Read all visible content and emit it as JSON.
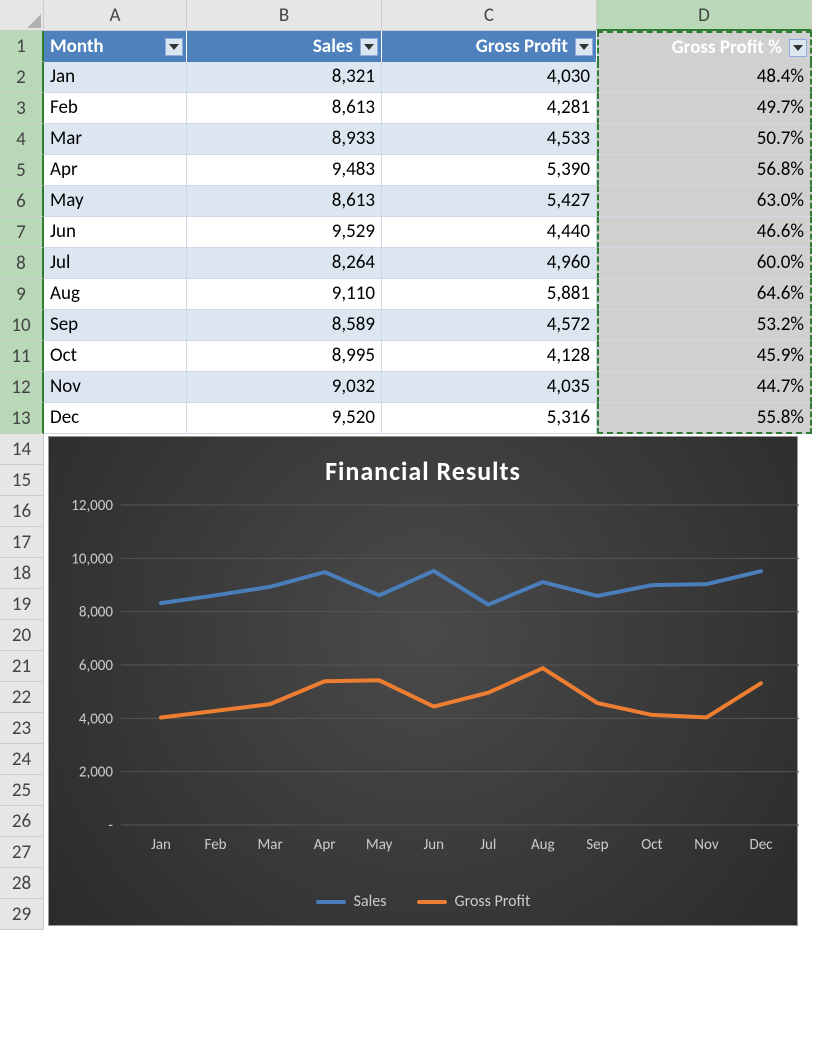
{
  "columns": [
    "A",
    "B",
    "C",
    "D"
  ],
  "headers": {
    "month": "Month",
    "sales": "Sales",
    "gross_profit": "Gross Profit",
    "gross_profit_pct": "Gross Profit %"
  },
  "rows": [
    {
      "n": 1
    },
    {
      "n": 2,
      "month": "Jan",
      "sales": "8,321",
      "gp": "4,030",
      "pct": "48.4%"
    },
    {
      "n": 3,
      "month": "Feb",
      "sales": "8,613",
      "gp": "4,281",
      "pct": "49.7%"
    },
    {
      "n": 4,
      "month": "Mar",
      "sales": "8,933",
      "gp": "4,533",
      "pct": "50.7%"
    },
    {
      "n": 5,
      "month": "Apr",
      "sales": "9,483",
      "gp": "5,390",
      "pct": "56.8%"
    },
    {
      "n": 6,
      "month": "May",
      "sales": "8,613",
      "gp": "5,427",
      "pct": "63.0%"
    },
    {
      "n": 7,
      "month": "Jun",
      "sales": "9,529",
      "gp": "4,440",
      "pct": "46.6%"
    },
    {
      "n": 8,
      "month": "Jul",
      "sales": "8,264",
      "gp": "4,960",
      "pct": "60.0%"
    },
    {
      "n": 9,
      "month": "Aug",
      "sales": "9,110",
      "gp": "5,881",
      "pct": "64.6%"
    },
    {
      "n": 10,
      "month": "Sep",
      "sales": "8,589",
      "gp": "4,572",
      "pct": "53.2%"
    },
    {
      "n": 11,
      "month": "Oct",
      "sales": "8,995",
      "gp": "4,128",
      "pct": "45.9%"
    },
    {
      "n": 12,
      "month": "Nov",
      "sales": "9,032",
      "gp": "4,035",
      "pct": "44.7%"
    },
    {
      "n": 13,
      "month": "Dec",
      "sales": "9,520",
      "gp": "5,316",
      "pct": "55.8%"
    }
  ],
  "extra_row_numbers": [
    14,
    15,
    16,
    17,
    18,
    19,
    20,
    21,
    22,
    23,
    24,
    25,
    26,
    27,
    28,
    29
  ],
  "chart_data": {
    "type": "line",
    "title": "Financial Results",
    "categories": [
      "Jan",
      "Feb",
      "Mar",
      "Apr",
      "May",
      "Jun",
      "Jul",
      "Aug",
      "Sep",
      "Oct",
      "Nov",
      "Dec"
    ],
    "series": [
      {
        "name": "Sales",
        "color": "#4a7ebb",
        "values": [
          8321,
          8613,
          8933,
          9483,
          8613,
          9529,
          8264,
          9110,
          8589,
          8995,
          9032,
          9520
        ]
      },
      {
        "name": "Gross Profit",
        "color": "#ed7d31",
        "values": [
          4030,
          4281,
          4533,
          5390,
          5427,
          4440,
          4960,
          5881,
          4572,
          4128,
          4035,
          5316
        ]
      }
    ],
    "yticks": [
      0,
      2000,
      4000,
      6000,
      8000,
      10000,
      12000
    ],
    "yticklabels": [
      "-",
      "2,000",
      "4,000",
      "6,000",
      "8,000",
      "10,000",
      "12,000"
    ],
    "ylim": [
      0,
      12000
    ],
    "legend": [
      "Sales",
      "Gross Profit"
    ]
  }
}
